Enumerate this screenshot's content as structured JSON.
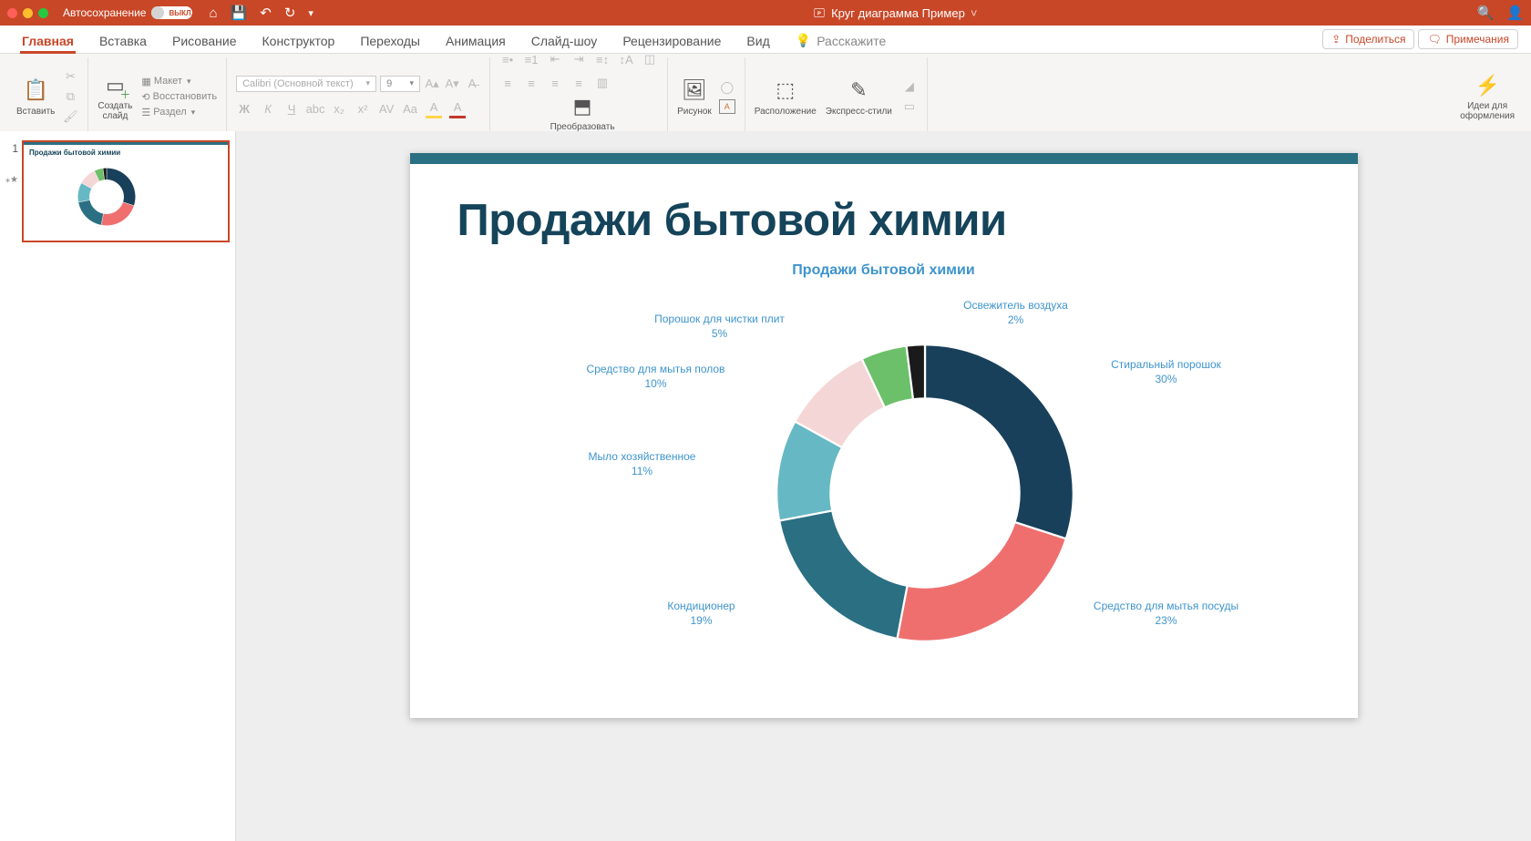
{
  "titlebar": {
    "autosave_label": "Автосохранение",
    "autosave_state": "ВЫКЛ.",
    "doc_title": "Круг диаграмма Пример"
  },
  "tabs": [
    "Главная",
    "Вставка",
    "Рисование",
    "Конструктор",
    "Переходы",
    "Анимация",
    "Слайд-шоу",
    "Рецензирование",
    "Вид"
  ],
  "active_tab": 0,
  "tellme": "Расскажите",
  "share": "Поделиться",
  "comments": "Примечания",
  "ribbon": {
    "paste": "Вставить",
    "new_slide": "Создать\nслайд",
    "layout": "Макет",
    "reset": "Восстановить",
    "section": "Раздел",
    "font_name": "Calibri (Основной текст)",
    "font_size": "9",
    "smartart": "Преобразовать\nв SmartArt",
    "picture": "Рисунок",
    "arrange": "Расположение",
    "quick_styles": "Экспресс-стили",
    "ideas": "Идеи для\nоформления"
  },
  "thumb": {
    "index": "1",
    "title": "Продажи бытовой химии"
  },
  "slide": {
    "title": "Продажи бытовой химии",
    "chart_title": "Продажи бытовой химии",
    "labels": {
      "l1": "Стиральный порошок\n30%",
      "l2": "Средство для мытья посуды\n23%",
      "l3": "Кондиционер\n19%",
      "l4": "Мыло хозяйственное\n11%",
      "l5": "Средство для мытья полов\n10%",
      "l6": "Порошок для чистки плит\n5%",
      "l7": "Освежитель воздуха\n2%"
    }
  },
  "chart_data": {
    "type": "pie",
    "title": "Продажи бытовой химии",
    "categories": [
      "Стиральный порошок",
      "Средство для мытья посуды",
      "Кондиционер",
      "Мыло хозяйственное",
      "Средство для мытья полов",
      "Порошок для чистки плит",
      "Освежитель воздуха"
    ],
    "values": [
      30,
      23,
      19,
      11,
      10,
      5,
      2
    ],
    "colors": [
      "#19405a",
      "#ef6f6f",
      "#2b6f83",
      "#66b8c4",
      "#f5d6d6",
      "#6cc06a",
      "#1a1a1a"
    ]
  }
}
